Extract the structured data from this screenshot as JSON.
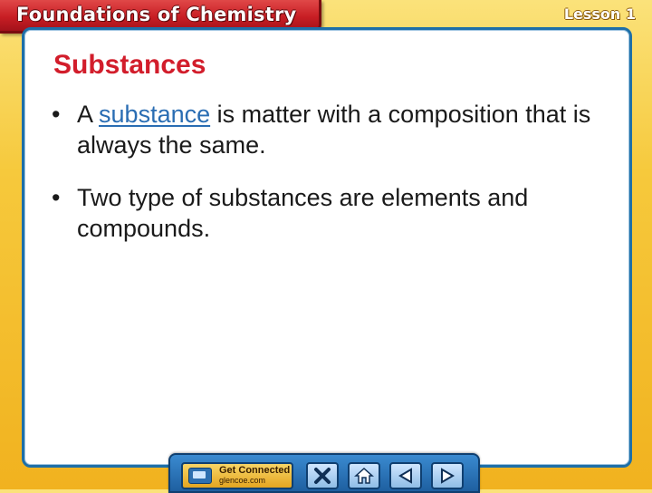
{
  "header": {
    "title": "Foundations of Chemistry",
    "lesson": "Lesson 1"
  },
  "slide": {
    "title": "Substances",
    "bullets": [
      {
        "mark": "•",
        "before": "A ",
        "term": "substance",
        "after": " is matter with a composition that is always the same."
      },
      {
        "mark": "•",
        "text": "Two type of substances are elements and compounds."
      }
    ]
  },
  "nav": {
    "get_connected_label": "Get Connected",
    "get_connected_site": "glencoe.com",
    "buttons": [
      {
        "icon": "close-icon"
      },
      {
        "icon": "home-icon"
      },
      {
        "icon": "previous-icon"
      },
      {
        "icon": "next-icon"
      }
    ]
  },
  "colors": {
    "background": "#f4c032",
    "header_tab": "#c81e24",
    "title_text": "#d21d2b",
    "term_link": "#2a6db3",
    "panel_border": "#1e6fa8"
  }
}
